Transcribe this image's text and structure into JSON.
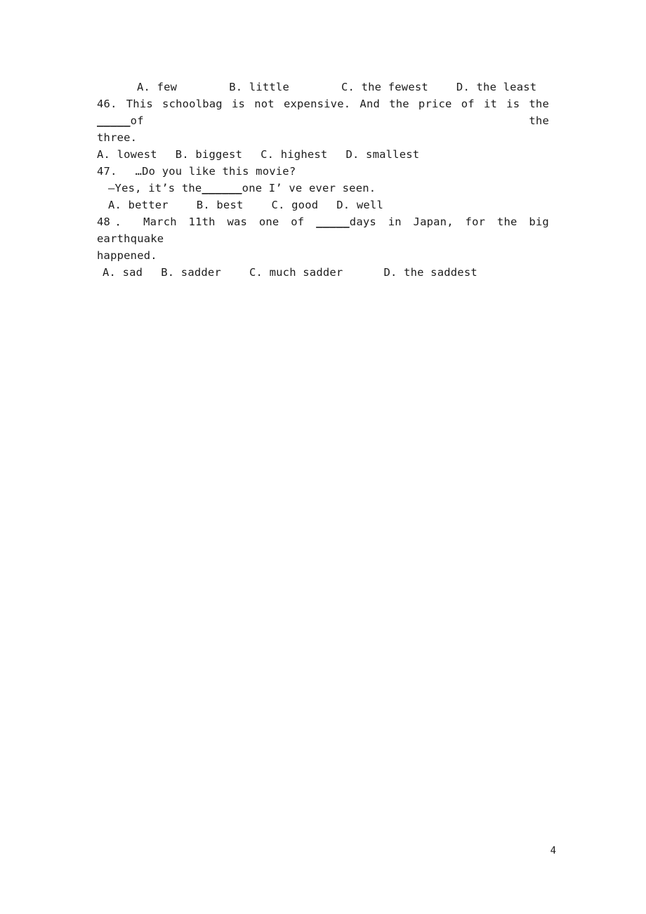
{
  "document": {
    "page_number": "4",
    "background_color": "#ffffff",
    "text_color": "#1c1c1c"
  },
  "lines": {
    "q45_options": {
      "a": "A. few",
      "b": "B. little",
      "c": "C. the fewest",
      "d": "D. the least"
    },
    "q46": {
      "number": "46.",
      "text_before_blank": "This schoolbag is not expensive. And the price of it is the",
      "blank": "_____",
      "text_after_blank": "of",
      "tail": "the",
      "continuation": "three.",
      "options": {
        "a": "A. lowest",
        "b": "B. biggest",
        "c": "C. highest",
        "d": "D. smallest"
      }
    },
    "q47": {
      "number": "47.",
      "prompt": "…Do you like this movie?",
      "reply_dash": "—",
      "reply_before_blank": "Yes, it’s the",
      "blank": "______",
      "reply_after_blank": "one I’ ve ever seen.",
      "options": {
        "a": "A. better",
        "b": "B. best",
        "c": "C. good",
        "d": "D. well"
      }
    },
    "q48": {
      "number": "48．",
      "text_before_blank": "March 11th",
      "mid": "was one of",
      "blank": "_____",
      "text_after_blank": "days in Japan,",
      "tail_1": "for the",
      "tail_2": "big earthquake",
      "continuation": "happened.",
      "options": {
        "a": "A. sad",
        "b": "B. sadder",
        "c": "C. much sadder",
        "d": "D. the saddest"
      }
    }
  }
}
